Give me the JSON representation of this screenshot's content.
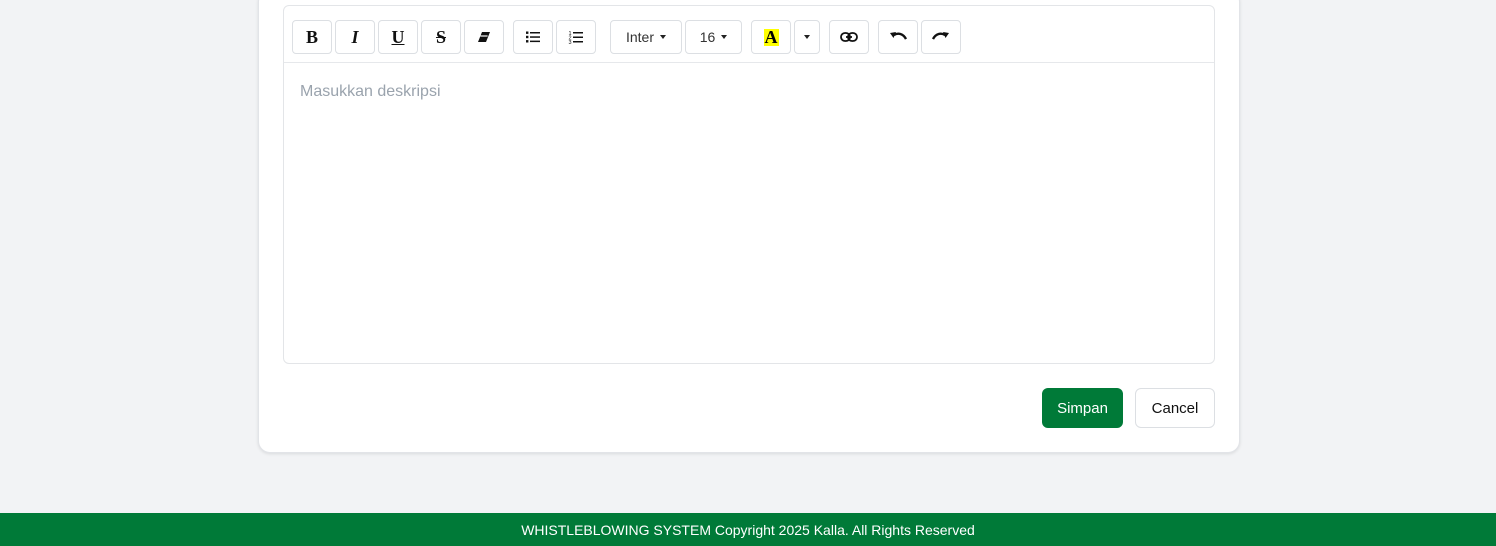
{
  "editor": {
    "placeholder": "Masukkan deskripsi",
    "toolbar": {
      "bold": "B",
      "italic": "I",
      "underline": "U",
      "strikethrough": "S",
      "font_family": "Inter",
      "font_size": "16",
      "highlight_glyph": "A",
      "highlight_color": "#ffff00",
      "icons": [
        "bold-icon",
        "italic-icon",
        "underline-icon",
        "strikethrough-icon",
        "eraser-icon",
        "unordered-list-icon",
        "ordered-list-icon",
        "highlight-icon",
        "chevron-down-icon",
        "link-icon",
        "undo-icon",
        "redo-icon"
      ]
    }
  },
  "actions": {
    "save_label": "Simpan",
    "cancel_label": "Cancel"
  },
  "footer": {
    "text": "WHISTLEBLOWING SYSTEM Copyright 2025 Kalla. All Rights Reserved"
  },
  "colors": {
    "brand_green": "#007a38",
    "page_background": "#f2f3f5"
  }
}
